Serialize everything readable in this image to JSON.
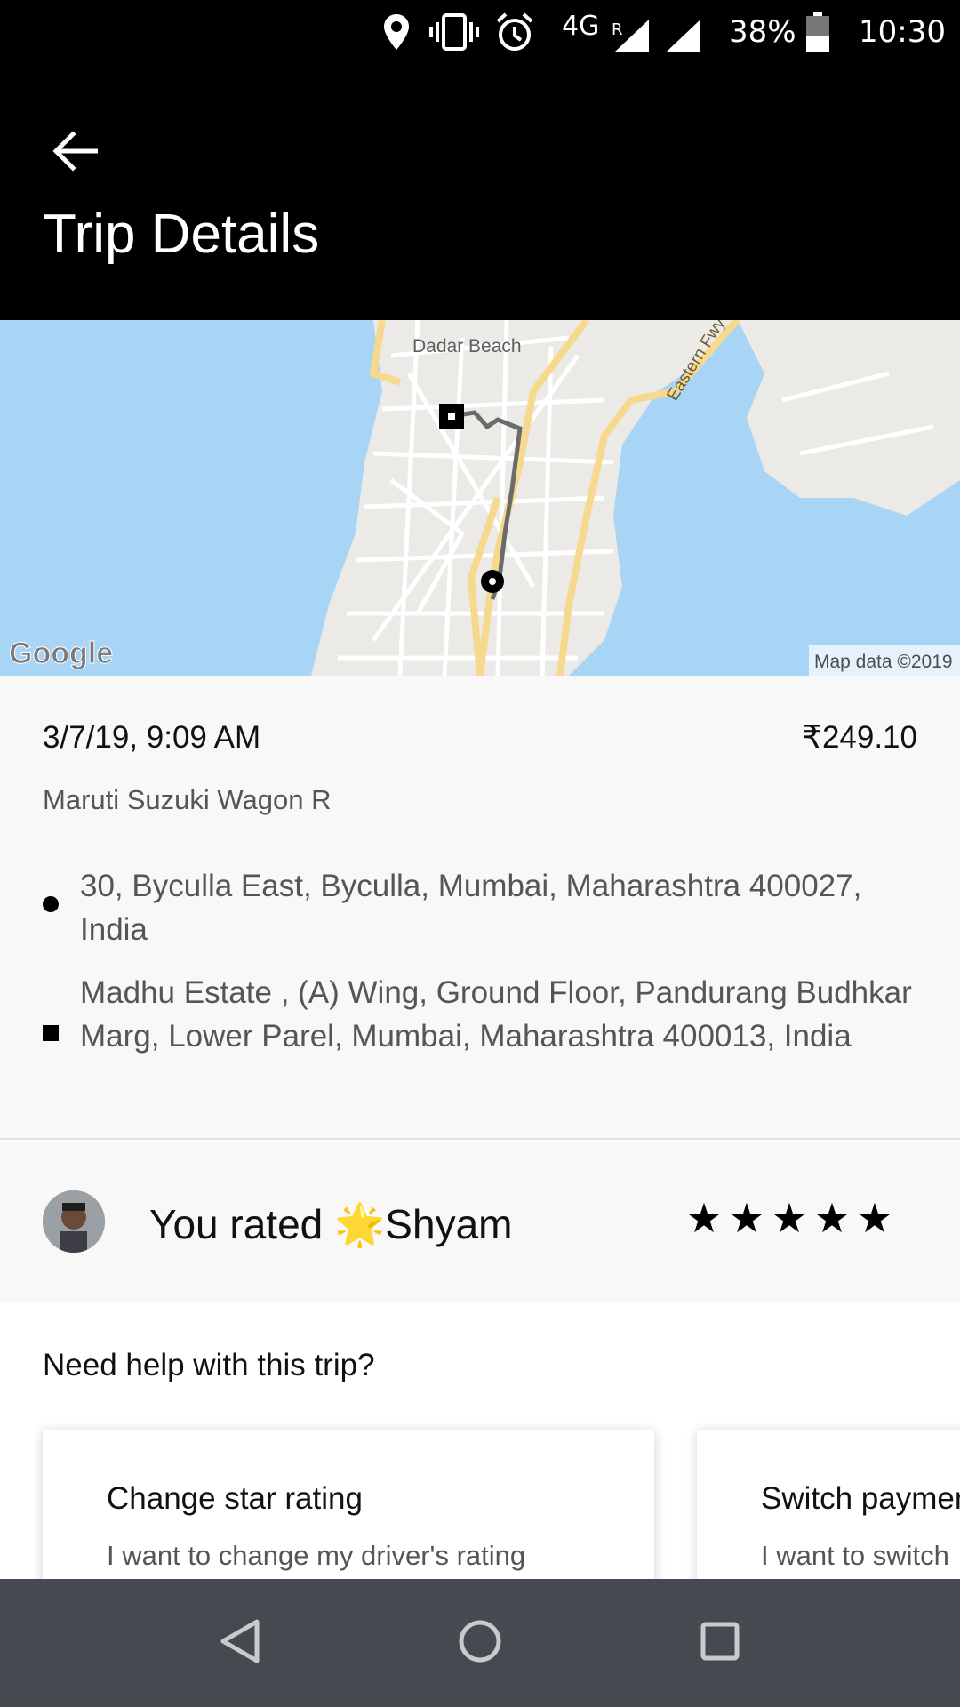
{
  "status_bar": {
    "network": "4G",
    "roaming": "R",
    "battery": "38%",
    "time": "10:30",
    "icons": [
      "location-icon",
      "vibrate-icon",
      "alarm-icon",
      "signal-icon",
      "signal-icon",
      "battery-icon"
    ]
  },
  "app_bar": {
    "title": "Trip Details",
    "back_icon": "arrow-left-icon"
  },
  "map": {
    "label_beach": "Dadar Beach",
    "label_road": "Eastern Fwy",
    "attribution_logo": "Google",
    "attribution_text": "Map data ©2019",
    "colors": {
      "water": "#a8d4f5",
      "land": "#ebeae6",
      "road": "#ffffff",
      "highway": "#f6d98c",
      "route": "#6b6b6b"
    }
  },
  "trip": {
    "date": "3/7/19, 9:09 AM",
    "price": "₹249.10",
    "car": "Maruti Suzuki Wagon R",
    "pickup": "30, Byculla East, Byculla, Mumbai, Maharashtra 400027, India",
    "dropoff": "Madhu Estate , (A) Wing, Ground Floor, Pandurang Budhkar Marg, Lower Parel, Mumbai, Maharashtra 400013, India"
  },
  "rating": {
    "text": "You rated 🌟Shyam",
    "stars": 5,
    "star_glyphs": [
      "★",
      "★",
      "★",
      "★",
      "★"
    ]
  },
  "help": {
    "title": "Need help with this trip?",
    "cards": [
      {
        "title": "Change star rating",
        "subtitle": "I want to change my driver's rating"
      },
      {
        "title": "Switch payment method",
        "subtitle": "I want to switch"
      }
    ]
  },
  "nav_bar": {
    "icons": [
      "back-triangle-icon",
      "home-circle-icon",
      "recents-square-icon"
    ]
  }
}
